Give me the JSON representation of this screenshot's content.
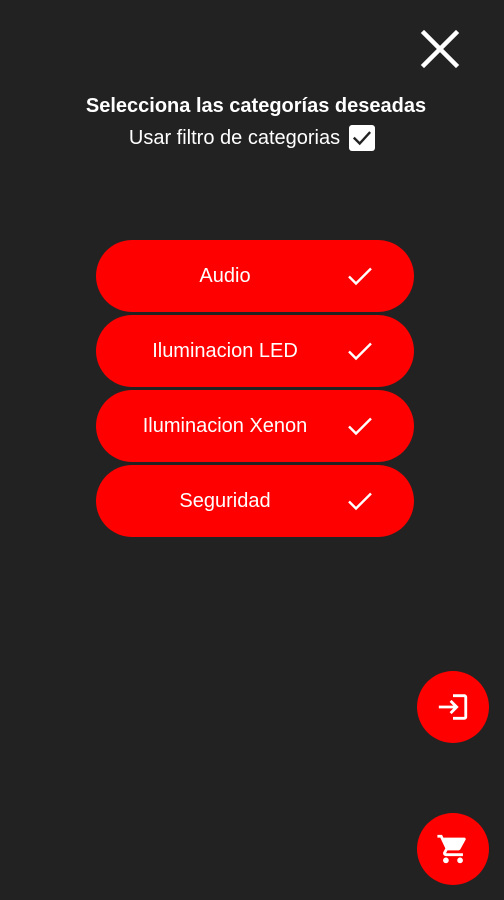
{
  "header": {
    "title": "Selecciona las categorías deseadas",
    "filter_label": "Usar filtro de categorias",
    "filter_checked": true,
    "close_icon": "close-icon"
  },
  "categories": [
    {
      "label": "Audio",
      "selected": true
    },
    {
      "label": "Iluminacion LED",
      "selected": true
    },
    {
      "label": "Iluminacion Xenon",
      "selected": true
    },
    {
      "label": "Seguridad",
      "selected": true
    }
  ],
  "fabs": {
    "login_icon": "login-icon",
    "cart_icon": "shopping-cart-icon"
  },
  "colors": {
    "background": "#222222",
    "accent": "#ff0000",
    "text": "#ffffff"
  }
}
